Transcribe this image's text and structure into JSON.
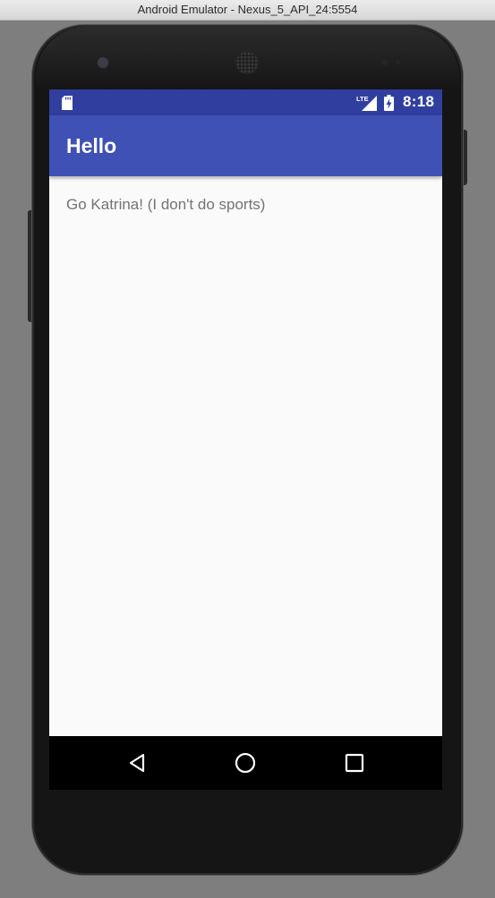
{
  "window": {
    "title": "Android Emulator - Nexus_5_API_24:5554"
  },
  "status_bar": {
    "time": "8:18",
    "network_label": "LTE",
    "icons": [
      "sd-card-icon",
      "lte-signal-icon",
      "battery-charging-icon"
    ]
  },
  "app_bar": {
    "title": "Hello"
  },
  "content": {
    "text": "Go Katrina! (I don't do sports)"
  },
  "nav_bar": {
    "buttons": [
      "back-icon",
      "home-icon",
      "recents-icon"
    ]
  },
  "colors": {
    "status_bar": "#303f9f",
    "app_bar": "#3f51b5",
    "screen_background": "#fafafa",
    "content_text": "#737373",
    "nav_bar": "#000000"
  }
}
